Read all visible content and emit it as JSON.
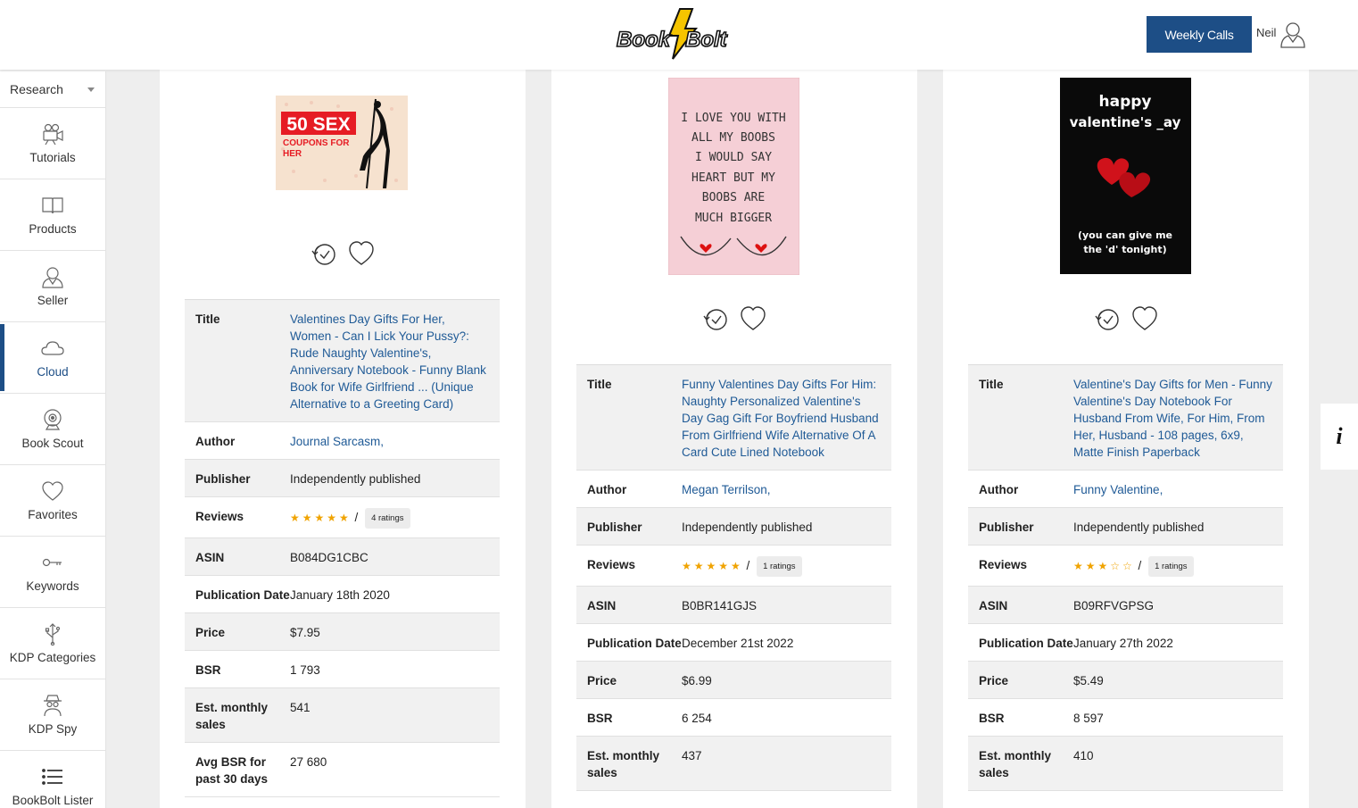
{
  "header": {
    "logo_text": "Book Bolt",
    "weekly_calls": "Weekly Calls",
    "user_name": "Neil"
  },
  "sidebar": {
    "research": "Research",
    "items": [
      {
        "label": "Tutorials",
        "icon": "video-camera-icon"
      },
      {
        "label": "Products",
        "icon": "open-book-icon"
      },
      {
        "label": "Seller",
        "icon": "user-icon"
      },
      {
        "label": "Cloud",
        "icon": "cloud-icon",
        "active": true
      },
      {
        "label": "Book Scout",
        "icon": "webcam-icon"
      },
      {
        "label": "Favorites",
        "icon": "heart-icon"
      },
      {
        "label": "Keywords",
        "icon": "key-icon"
      },
      {
        "label": "KDP Categories",
        "icon": "usb-icon"
      },
      {
        "label": "KDP Spy",
        "icon": "spy-icon"
      },
      {
        "label": "BookBolt Lister",
        "icon": "list-icon"
      }
    ]
  },
  "labels": {
    "title": "Title",
    "author": "Author",
    "publisher": "Publisher",
    "reviews": "Reviews",
    "asin": "ASIN",
    "pub_date": "Publication Date",
    "price": "Price",
    "bsr": "BSR",
    "est_sales": "Est. monthly sales",
    "avg_bsr": "Avg BSR for past 30 days"
  },
  "products": [
    {
      "cover_line1": "50 SEX",
      "cover_line2": "COUPONS FOR",
      "cover_line3": "HER",
      "title": "Valentines Day Gifts For Her, Women - Can I Lick Your Pussy?: Rude Naughty Valentine's, Anniversary Notebook - Funny Blank Book for Wife Girlfriend ... (Unique Alternative to a Greeting Card)",
      "author": "Journal Sarcasm,",
      "publisher": "Independently published",
      "rating": 5,
      "stars": "★★★★★",
      "ratings_text": "4 ratings",
      "asin": "B084DG1CBC",
      "pub_date": "January 18th 2020",
      "price": "$7.95",
      "bsr": "1 793",
      "est_sales": "541",
      "avg_bsr": "27 680"
    },
    {
      "cover_lines": [
        "I LOVE YOU WITH",
        "ALL MY BOOBS",
        "I WOULD SAY",
        "HEART BUT MY",
        "BOOBS ARE",
        "MUCH BIGGER"
      ],
      "title": "Funny Valentines Day Gifts For Him: Naughty Personalized Valentine's Day Gag Gift For Boyfriend Husband From Girlfriend Wife Alternative Of A Card Cute Lined Notebook",
      "author": "Megan Terrilson,",
      "publisher": "Independently published",
      "rating": 5,
      "stars": "★★★★★",
      "ratings_text": "1 ratings",
      "asin": "B0BR141GJS",
      "pub_date": "December 21st 2022",
      "price": "$6.99",
      "bsr": "6 254",
      "est_sales": "437"
    },
    {
      "cover_line1": "happy",
      "cover_line2": "valentine's _ay",
      "cover_line3": "(you can give me",
      "cover_line4": "the 'd' tonight)",
      "title": "Valentine's Day Gifts for Men - Funny Valentine's Day Notebook For Husband From Wife, For Him, From Her, Husband - 108 pages, 6x9, Matte Finish Paperback",
      "author": "Funny Valentine,",
      "publisher": "Independently published",
      "rating": 3,
      "stars": "★★★☆☆",
      "ratings_text": "1 ratings",
      "asin": "B09RFVGPSG",
      "pub_date": "January 27th 2022",
      "price": "$5.49",
      "bsr": "8 597",
      "est_sales": "410"
    }
  ],
  "info_tab": "i"
}
